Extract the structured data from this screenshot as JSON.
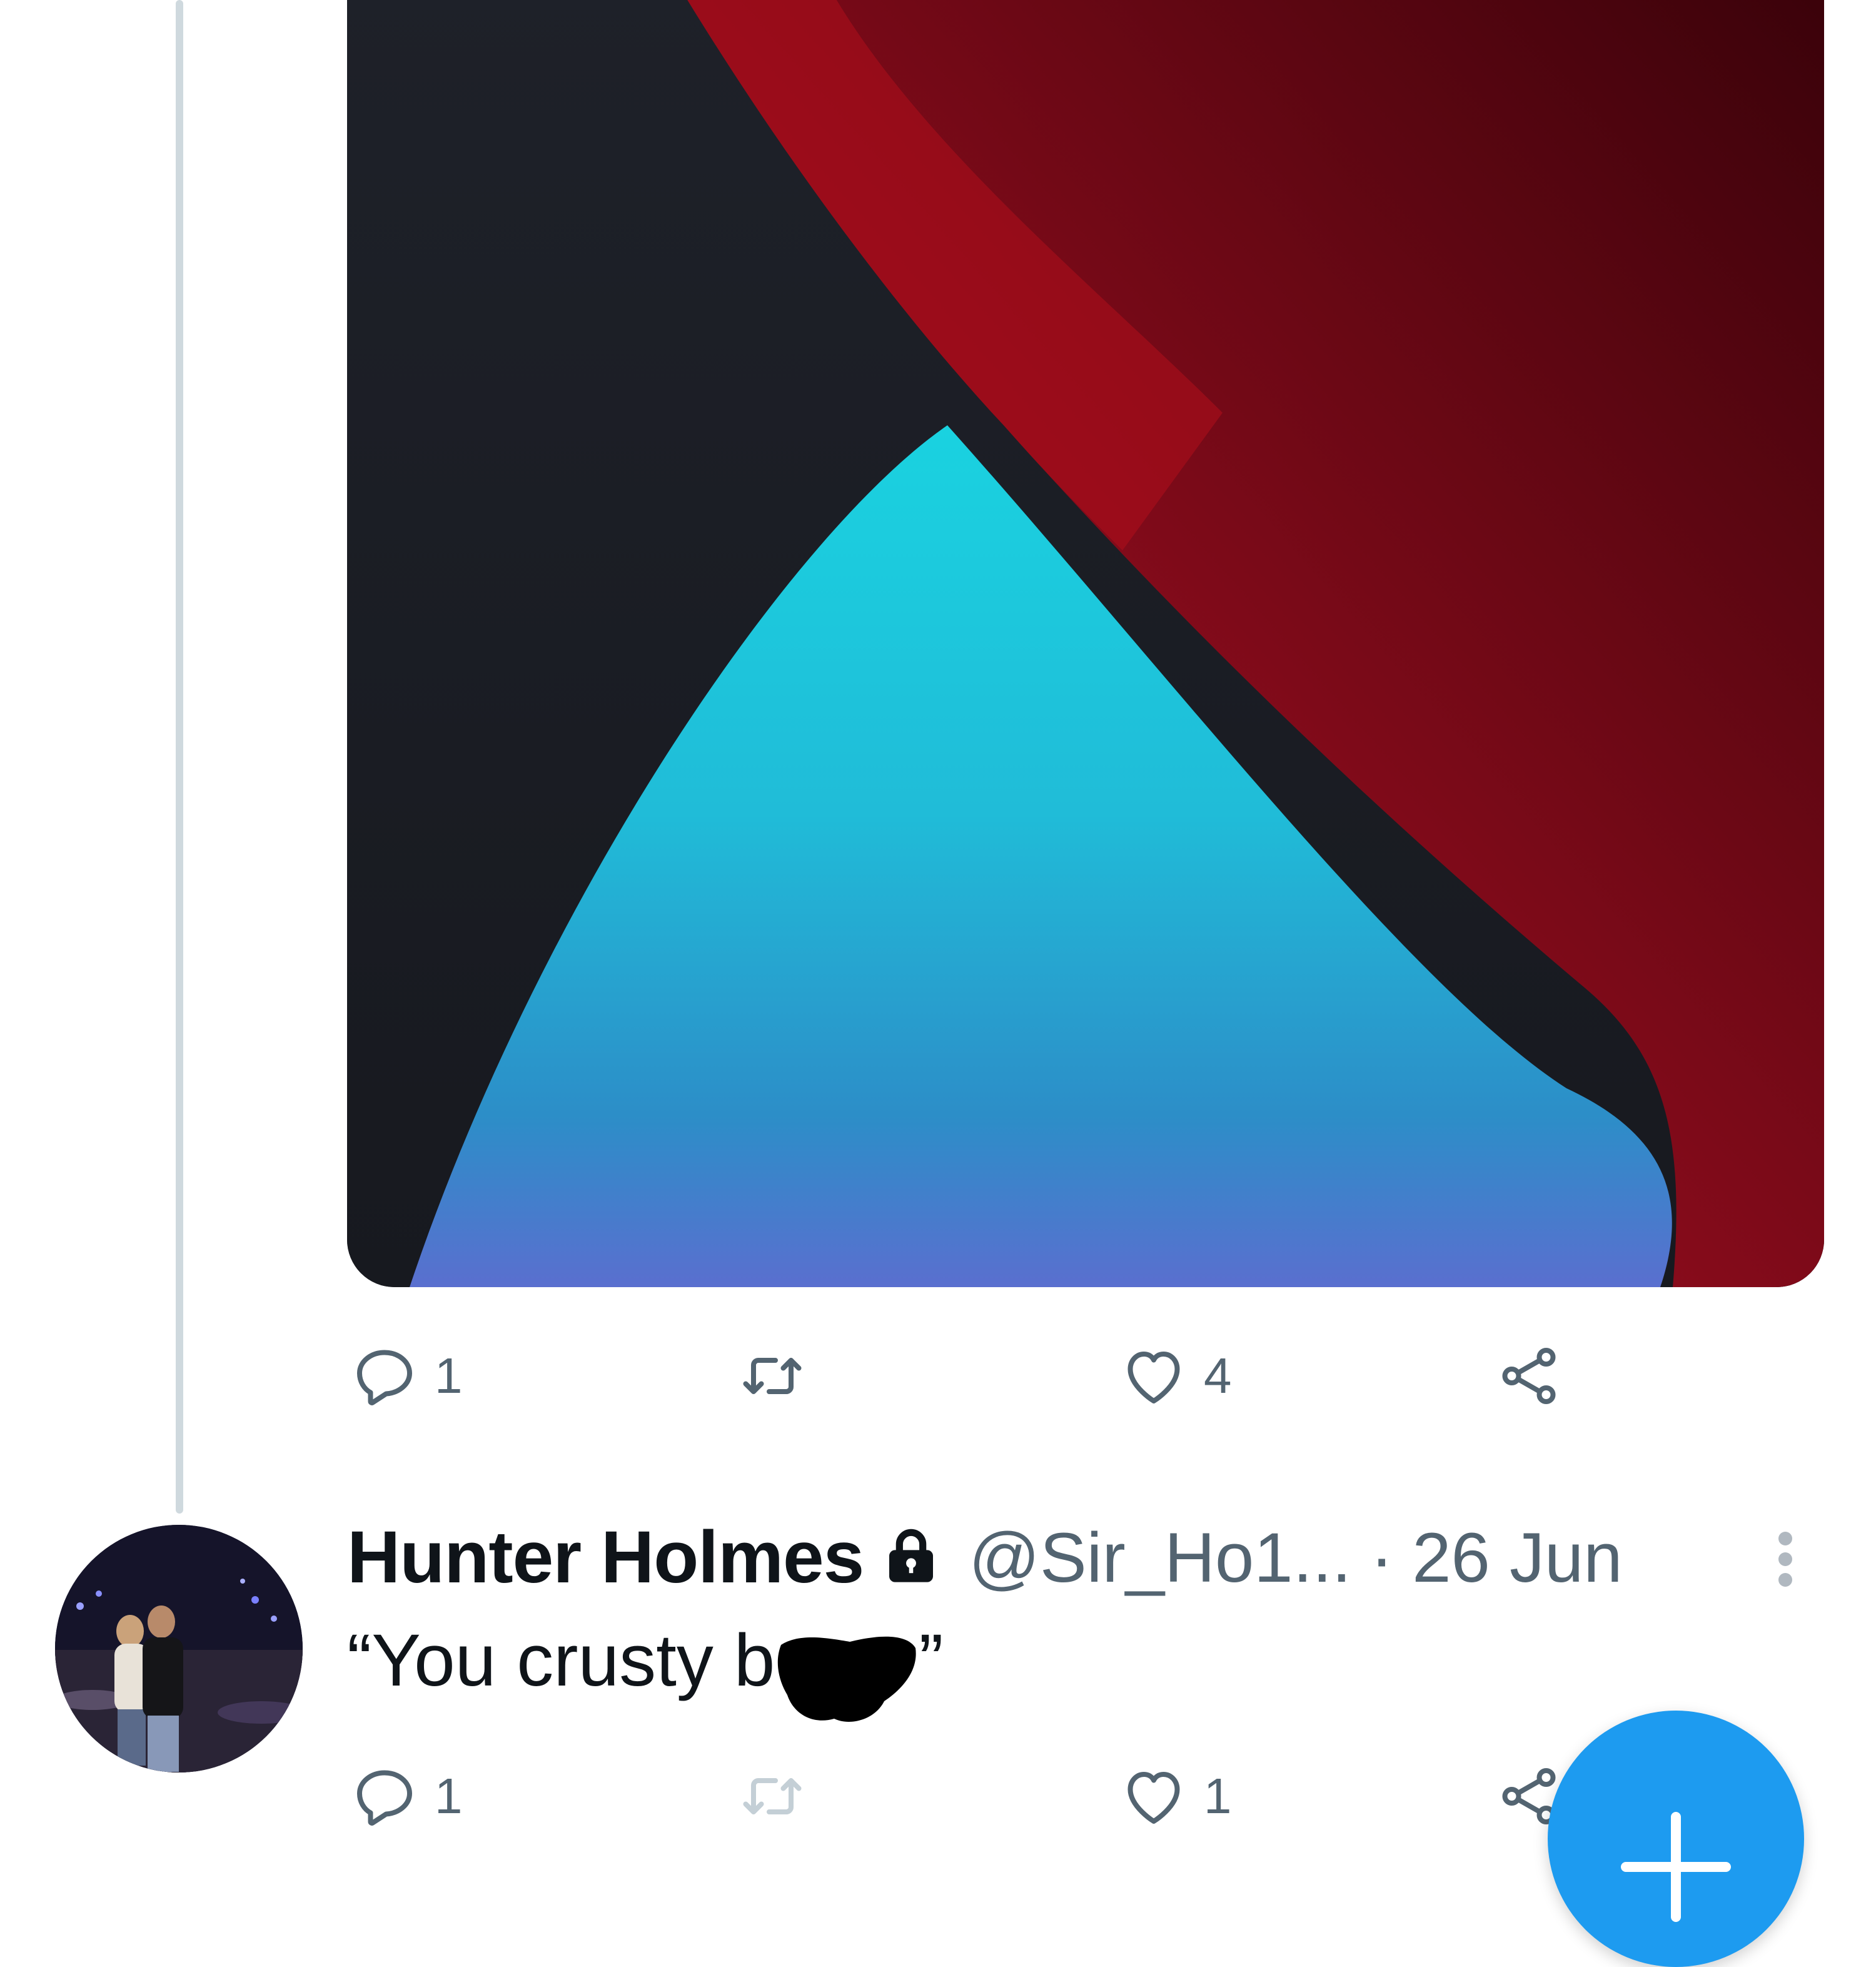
{
  "tweet_one": {
    "actions": {
      "reply_count": "1",
      "retweet_count": "",
      "like_count": "4"
    }
  },
  "tweet_two": {
    "author": {
      "display_name": "Hunter Holmes",
      "handle": "@Sir_Ho1...",
      "protected": true
    },
    "separator": "·",
    "date": "26 Jun",
    "text_before_redaction": "“You crusty b",
    "text_after_redaction": "”",
    "actions": {
      "reply_count": "1",
      "retweet_count": "",
      "like_count": "1"
    }
  },
  "icons": {
    "reply": "reply-icon",
    "retweet": "retweet-icon",
    "like": "heart-icon",
    "share": "share-icon",
    "lock": "lock-icon",
    "more": "more-vertical-icon",
    "compose": "plus-icon"
  },
  "colors": {
    "accent": "#1d9bf0",
    "secondary_text": "#536471",
    "primary_text": "#0f1419",
    "thread_line": "#cfd9de"
  }
}
